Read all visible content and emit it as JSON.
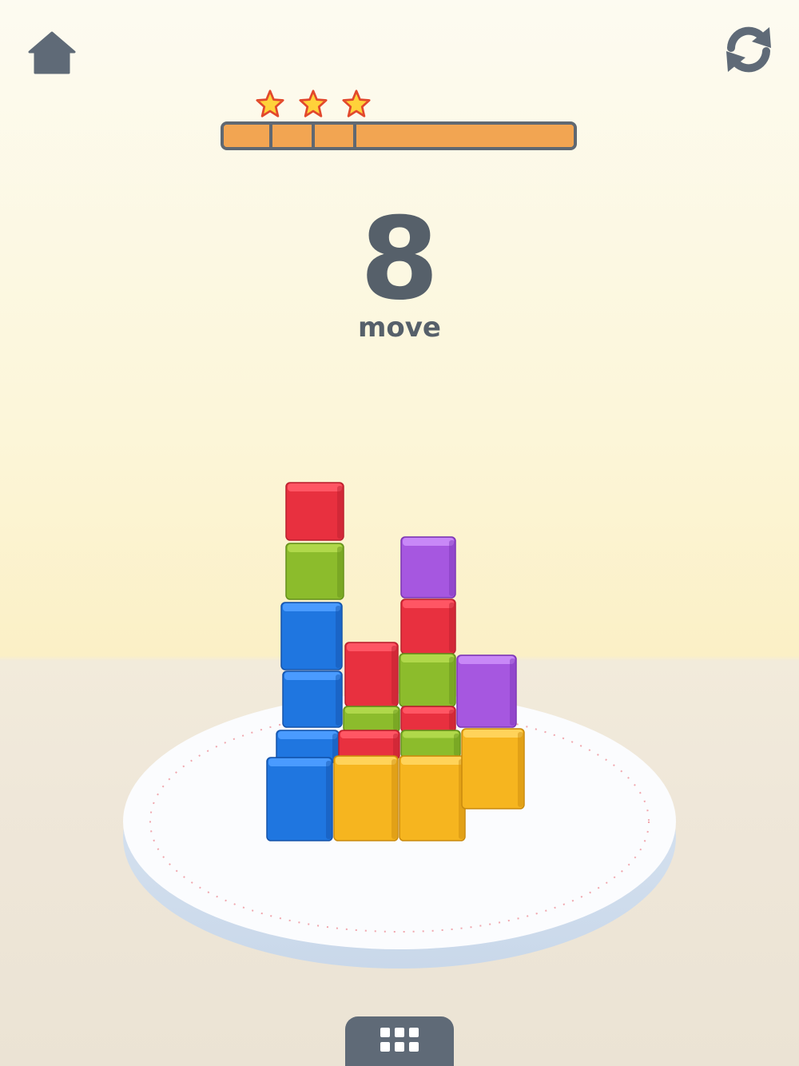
{
  "header": {
    "home_icon": "home-icon",
    "restart_icon": "restart-icon"
  },
  "progress": {
    "stars_earned": 3,
    "fill": 1.0,
    "thresholds": [
      0.13,
      0.25,
      0.37
    ]
  },
  "moves": {
    "count": "8",
    "label": "move"
  },
  "colors": {
    "red": "#e8303f",
    "green": "#8cbc2c",
    "blue": "#1f76e0",
    "purple": "#a657e0",
    "yellow": "#f6b51f",
    "text": "#56606a",
    "bar_fill": "#f2a552",
    "bar_border": "#5f6872"
  },
  "board": {
    "cubes": [
      {
        "color": "red"
      },
      {
        "color": "green"
      },
      {
        "color": "blue"
      },
      {
        "color": "blue"
      },
      {
        "color": "blue"
      },
      {
        "color": "blue"
      },
      {
        "color": "red"
      },
      {
        "color": "green"
      },
      {
        "color": "red"
      },
      {
        "color": "yellow"
      },
      {
        "color": "purple"
      },
      {
        "color": "red"
      },
      {
        "color": "green"
      },
      {
        "color": "red"
      },
      {
        "color": "green"
      },
      {
        "color": "yellow"
      },
      {
        "color": "purple"
      },
      {
        "color": "yellow"
      }
    ]
  },
  "footer": {
    "menu_icon": "level-grid-icon"
  }
}
